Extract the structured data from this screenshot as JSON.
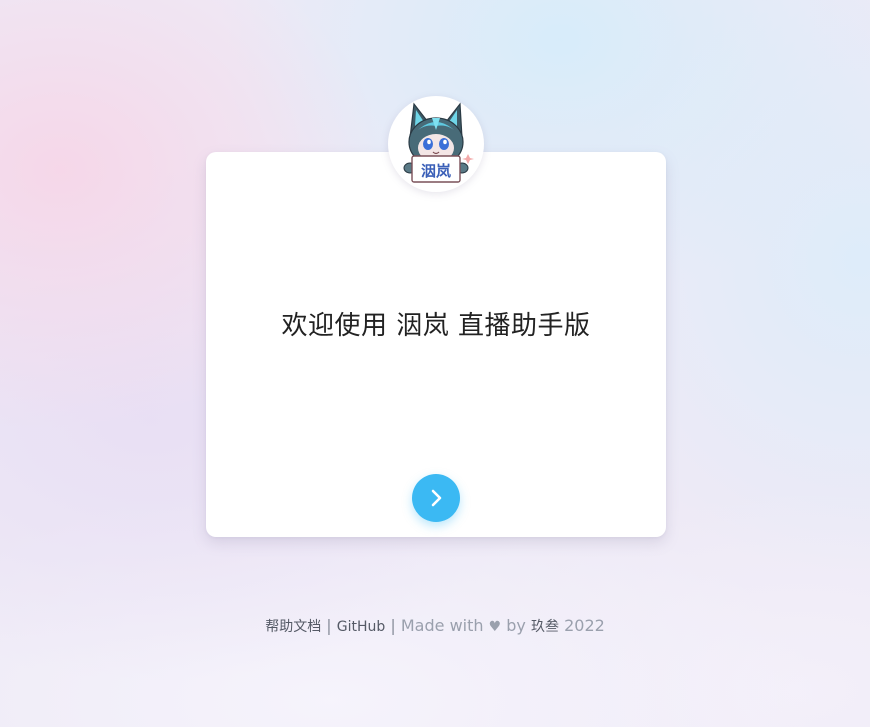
{
  "card": {
    "welcome_text": "欢迎使用 洇岚 直播助手版"
  },
  "avatar": {
    "alt": "洇岚",
    "badge_text": "洇岚"
  },
  "next_button": {
    "icon": "chevron-right-icon",
    "color": "#3bb9f3"
  },
  "footer": {
    "docs_label": "帮助文档",
    "separator": "|",
    "github_label": "GitHub",
    "made_with": "Made with",
    "heart": "♥",
    "by": "by",
    "author": "玖叁",
    "year": "2022"
  }
}
